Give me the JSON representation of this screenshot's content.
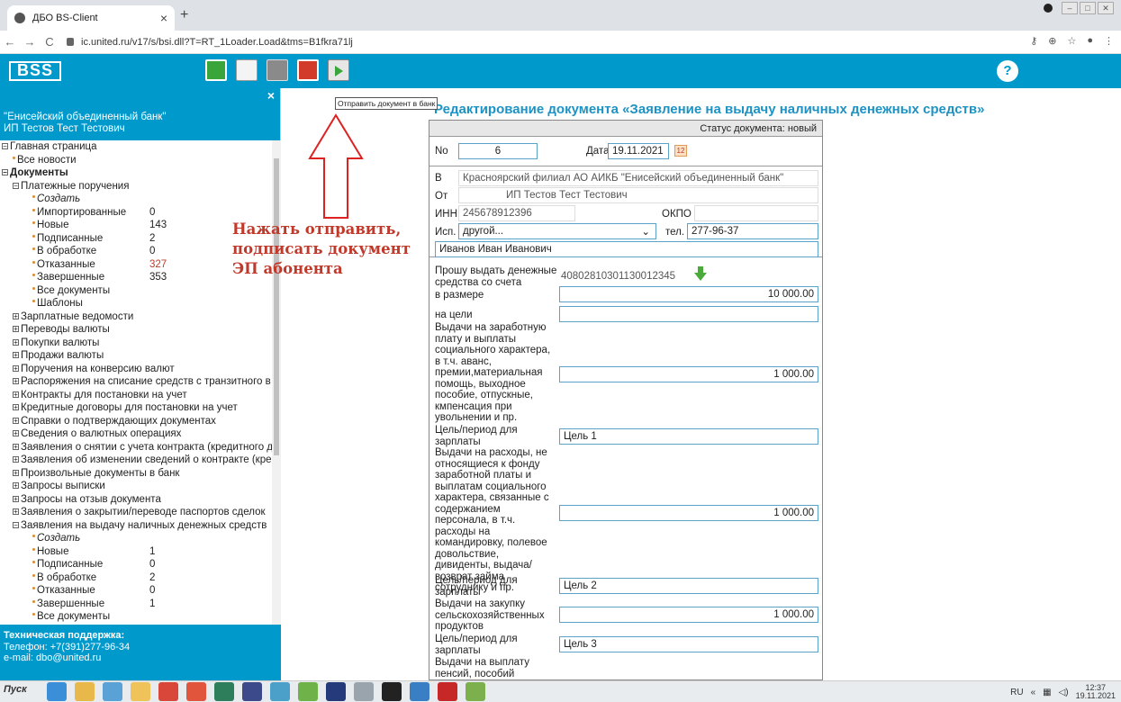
{
  "browser": {
    "tab_title": "ДБО BS-Client",
    "tab_close": "×",
    "new_tab": "+",
    "url": "ic.united.ru/v17/s/bsi.dll?T=RT_1Loader.Load&tms=B1fkra71lj"
  },
  "app": {
    "logo": "BSS",
    "help": "?",
    "tooltip": "Отправить документ в банк",
    "annotation": [
      "Нажать отправить,",
      "подписать документ",
      "ЭП абонента"
    ]
  },
  "sidebar": {
    "close": "×",
    "bank": "\"Енисейский объединенный банк\"",
    "user": "ИП Тестов Тест Тестович",
    "tree": [
      {
        "label": "Главная страница",
        "level": 0,
        "marker": "⊟"
      },
      {
        "label": "Все новости",
        "level": 1,
        "marker": "•"
      },
      {
        "label": "Документы",
        "level": 0,
        "marker": "⊟",
        "bold": true
      },
      {
        "label": "Платежные поручения",
        "level": 1,
        "marker": "⊟"
      },
      {
        "label": "Создать",
        "level": 2,
        "marker": "•",
        "italic": true
      },
      {
        "label": "Импортированные",
        "level": 2,
        "marker": "•",
        "count": "0"
      },
      {
        "label": "Новые",
        "level": 2,
        "marker": "•",
        "count": "143"
      },
      {
        "label": "Подписанные",
        "level": 2,
        "marker": "•",
        "count": "2"
      },
      {
        "label": "В обработке",
        "level": 2,
        "marker": "•",
        "count": "0"
      },
      {
        "label": "Отказанные",
        "level": 2,
        "marker": "•",
        "count": "327",
        "red": true
      },
      {
        "label": "Завершенные",
        "level": 2,
        "marker": "•",
        "count": "353"
      },
      {
        "label": "Все документы",
        "level": 2,
        "marker": "•"
      },
      {
        "label": "Шаблоны",
        "level": 2,
        "marker": "•"
      },
      {
        "label": "Зарплатные ведомости",
        "level": 1,
        "marker": "⊞"
      },
      {
        "label": "Переводы валюты",
        "level": 1,
        "marker": "⊞"
      },
      {
        "label": "Покупки валюты",
        "level": 1,
        "marker": "⊞"
      },
      {
        "label": "Продажи валюты",
        "level": 1,
        "marker": "⊞"
      },
      {
        "label": "Поручения на конверсию валют",
        "level": 1,
        "marker": "⊞"
      },
      {
        "label": "Распоряжения на списание средств с транзитного в",
        "level": 1,
        "marker": "⊞"
      },
      {
        "label": "Контракты для постановки на учет",
        "level": 1,
        "marker": "⊞"
      },
      {
        "label": "Кредитные договоры для постановки на учет",
        "level": 1,
        "marker": "⊞"
      },
      {
        "label": "Справки о подтверждающих документах",
        "level": 1,
        "marker": "⊞"
      },
      {
        "label": "Сведения о валютных операциях",
        "level": 1,
        "marker": "⊞"
      },
      {
        "label": "Заявления о снятии с учета контракта (кредитного д",
        "level": 1,
        "marker": "⊞"
      },
      {
        "label": "Заявления об изменении сведений о контракте (кре",
        "level": 1,
        "marker": "⊞"
      },
      {
        "label": "Произвольные документы в банк",
        "level": 1,
        "marker": "⊞"
      },
      {
        "label": "Запросы выписки",
        "level": 1,
        "marker": "⊞"
      },
      {
        "label": "Запросы на отзыв документа",
        "level": 1,
        "marker": "⊞"
      },
      {
        "label": "Заявления о закрытии/переводе паспортов сделок",
        "level": 1,
        "marker": "⊞"
      },
      {
        "label": "Заявления на выдачу наличных денежных средств",
        "level": 1,
        "marker": "⊟"
      },
      {
        "label": "Создать",
        "level": 2,
        "marker": "•",
        "italic": true
      },
      {
        "label": "Новые",
        "level": 2,
        "marker": "•",
        "count": "1"
      },
      {
        "label": "Подписанные",
        "level": 2,
        "marker": "•",
        "count": "0"
      },
      {
        "label": "В обработке",
        "level": 2,
        "marker": "•",
        "count": "2"
      },
      {
        "label": "Отказанные",
        "level": 2,
        "marker": "•",
        "count": "0"
      },
      {
        "label": "Завершенные",
        "level": 2,
        "marker": "•",
        "count": "1"
      },
      {
        "label": "Все документы",
        "level": 2,
        "marker": "•"
      }
    ],
    "support_title": "Техническая поддержка:",
    "support_phone": "Телефон: +7(391)277-96-34",
    "support_email": "e-mail: dbo@united.ru"
  },
  "form": {
    "title": "Редактирование документа «Заявление на выдачу наличных денежных средств»",
    "status_label": "Статус документа:",
    "status_value": "новый",
    "no_label": "No",
    "no_value": "6",
    "date_label": "Дата",
    "date_value": "19.11.2021",
    "cal_icon_text": "12",
    "to_label": "В",
    "to_value": "Красноярский филиал АО АИКБ \"Енисейский объединенный банк\"",
    "from_label": "От",
    "from_value": "ИП Тестов Тест Тестович",
    "inn_label": "ИНН",
    "inn_value": "245678912396",
    "okpo_label": "ОКПО",
    "isp_label": "Исп.",
    "isp_value": "другой...",
    "tel_label": "тел.",
    "tel_value": "277-96-37",
    "person": "Иванов Иван Иванович",
    "account_label": "Прошу выдать денежные средства со счета",
    "account_value": "40802810301130012345",
    "amount_label": "в размере",
    "amount_value": "10 000.00",
    "purpose_label": "на цели",
    "purpose_value": "",
    "item1_label": "Выдачи на заработную плату и выплаты социального характера, в т.ч. аванс, премии,материальная помощь, выходное пособие, отпускные, кмпенсация при увольнении и пр.",
    "item1_value": "1 000.00",
    "goal_label": "Цель/период для зарплаты",
    "goal1_value": "Цель 1",
    "item2_label": "Выдачи на расходы, не относящиеся к фонду заработной платы и выплатам социального характера, связанные с содержанием персонала, в т.ч. расходы на командировку, полевое довольствие, дивиденты, выдача/возврат займа сотруднику и пр.",
    "item2_value": "1 000.00",
    "goal2_value": "Цель 2",
    "item3_label": "Выдачи на закупку сельскохозяйственных продуктов",
    "item3_value": "1 000.00",
    "goal3_value": "Цель 3",
    "item4_label": "Выдачи на выплату пенсий, пособий"
  },
  "taskbar": {
    "start": "Пуск",
    "lang": "RU",
    "time": "12:37",
    "date": "19.11.2021"
  },
  "colors": {
    "header_blue": "#0099cc",
    "title_blue": "#1c93c4",
    "annotation_red": "#c0392b"
  }
}
